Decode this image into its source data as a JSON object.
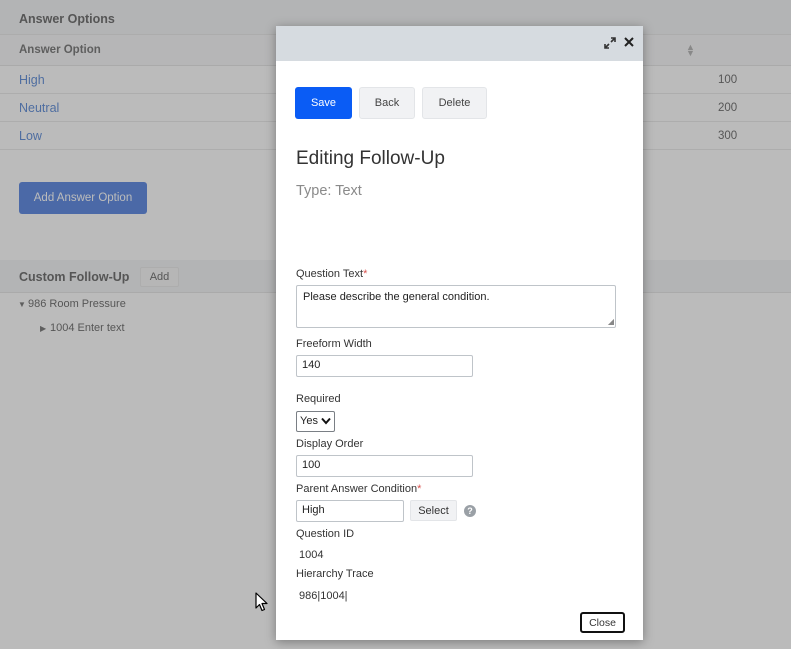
{
  "answer_options": {
    "title": "Answer Options",
    "column_header": "Answer Option",
    "rows": [
      {
        "label": "High",
        "value": "100"
      },
      {
        "label": "Neutral",
        "value": "200"
      },
      {
        "label": "Low",
        "value": "300"
      }
    ],
    "add_button": "Add Answer Option"
  },
  "custom_followup": {
    "title": "Custom Follow-Up",
    "add_button": "Add",
    "tree": [
      {
        "label": "986 Room Pressure"
      },
      {
        "label": "1004 Enter text"
      }
    ]
  },
  "modal": {
    "buttons": {
      "save": "Save",
      "back": "Back",
      "delete": "Delete",
      "close": "Close"
    },
    "title": "Editing Follow-Up",
    "subtitle": "Type: Text",
    "fields": {
      "question_text": {
        "label": "Question Text",
        "value": "Please describe the general condition."
      },
      "freeform_width": {
        "label": "Freeform Width",
        "value": "140"
      },
      "required": {
        "label": "Required",
        "value": "Yes"
      },
      "display_order": {
        "label": "Display Order",
        "value": "100"
      },
      "parent_answer_condition": {
        "label": "Parent Answer Condition",
        "value": "High",
        "select_button": "Select"
      },
      "question_id": {
        "label": "Question ID",
        "value": "1004"
      },
      "hierarchy_trace": {
        "label": "Hierarchy Trace",
        "value": "986|1004|"
      }
    },
    "required_marker": "*",
    "help_glyph": "?"
  },
  "colors": {
    "primary": "#0a5cf5",
    "link": "#2563c9",
    "modal_bar": "#d6dbe0",
    "required_marker": "#d9534f"
  }
}
